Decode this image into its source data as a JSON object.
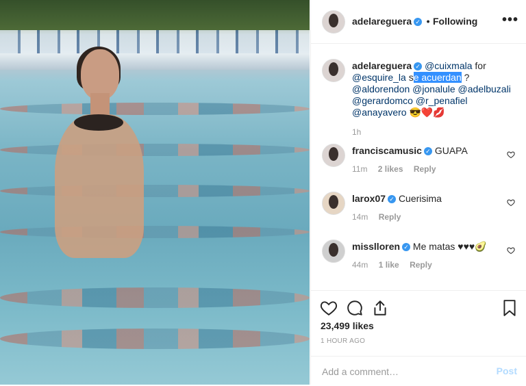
{
  "header": {
    "username": "adelareguera",
    "separator": "•",
    "follow_status": "Following",
    "more_label": "•••"
  },
  "caption": {
    "username": "adelareguera",
    "text_parts": [
      "@cuixmala",
      " for ",
      "@esquire_la",
      " s",
      "e acuerdan",
      " ?",
      "@aldorendon",
      "@jonalule",
      "@adelbuzali",
      "@gerardomco",
      "@r_penafiel",
      "@anayavero",
      "😎❤️💋"
    ],
    "time": "1h"
  },
  "comments": [
    {
      "username": "franciscamusic",
      "text": "GUAPA",
      "time": "11m",
      "likes": "2 likes",
      "reply": "Reply"
    },
    {
      "username": "larox07",
      "text": "Cuerisima",
      "time": "14m",
      "likes": "",
      "reply": "Reply"
    },
    {
      "username": "misslloren",
      "text": "Me matas ♥♥♥🥑",
      "time": "44m",
      "likes": "1 like",
      "reply": "Reply"
    }
  ],
  "stats": {
    "likes": "23,499 likes",
    "posted": "1 HOUR AGO"
  },
  "comment_box": {
    "placeholder": "Add a comment…",
    "post_label": "Post"
  },
  "colors": {
    "verified": "#3897f0",
    "mention": "#003569",
    "post_disabled": "#b3dbff"
  },
  "icons": [
    "verified-icon",
    "more-options-icon",
    "heart-icon",
    "comment-icon",
    "share-icon",
    "bookmark-icon"
  ]
}
